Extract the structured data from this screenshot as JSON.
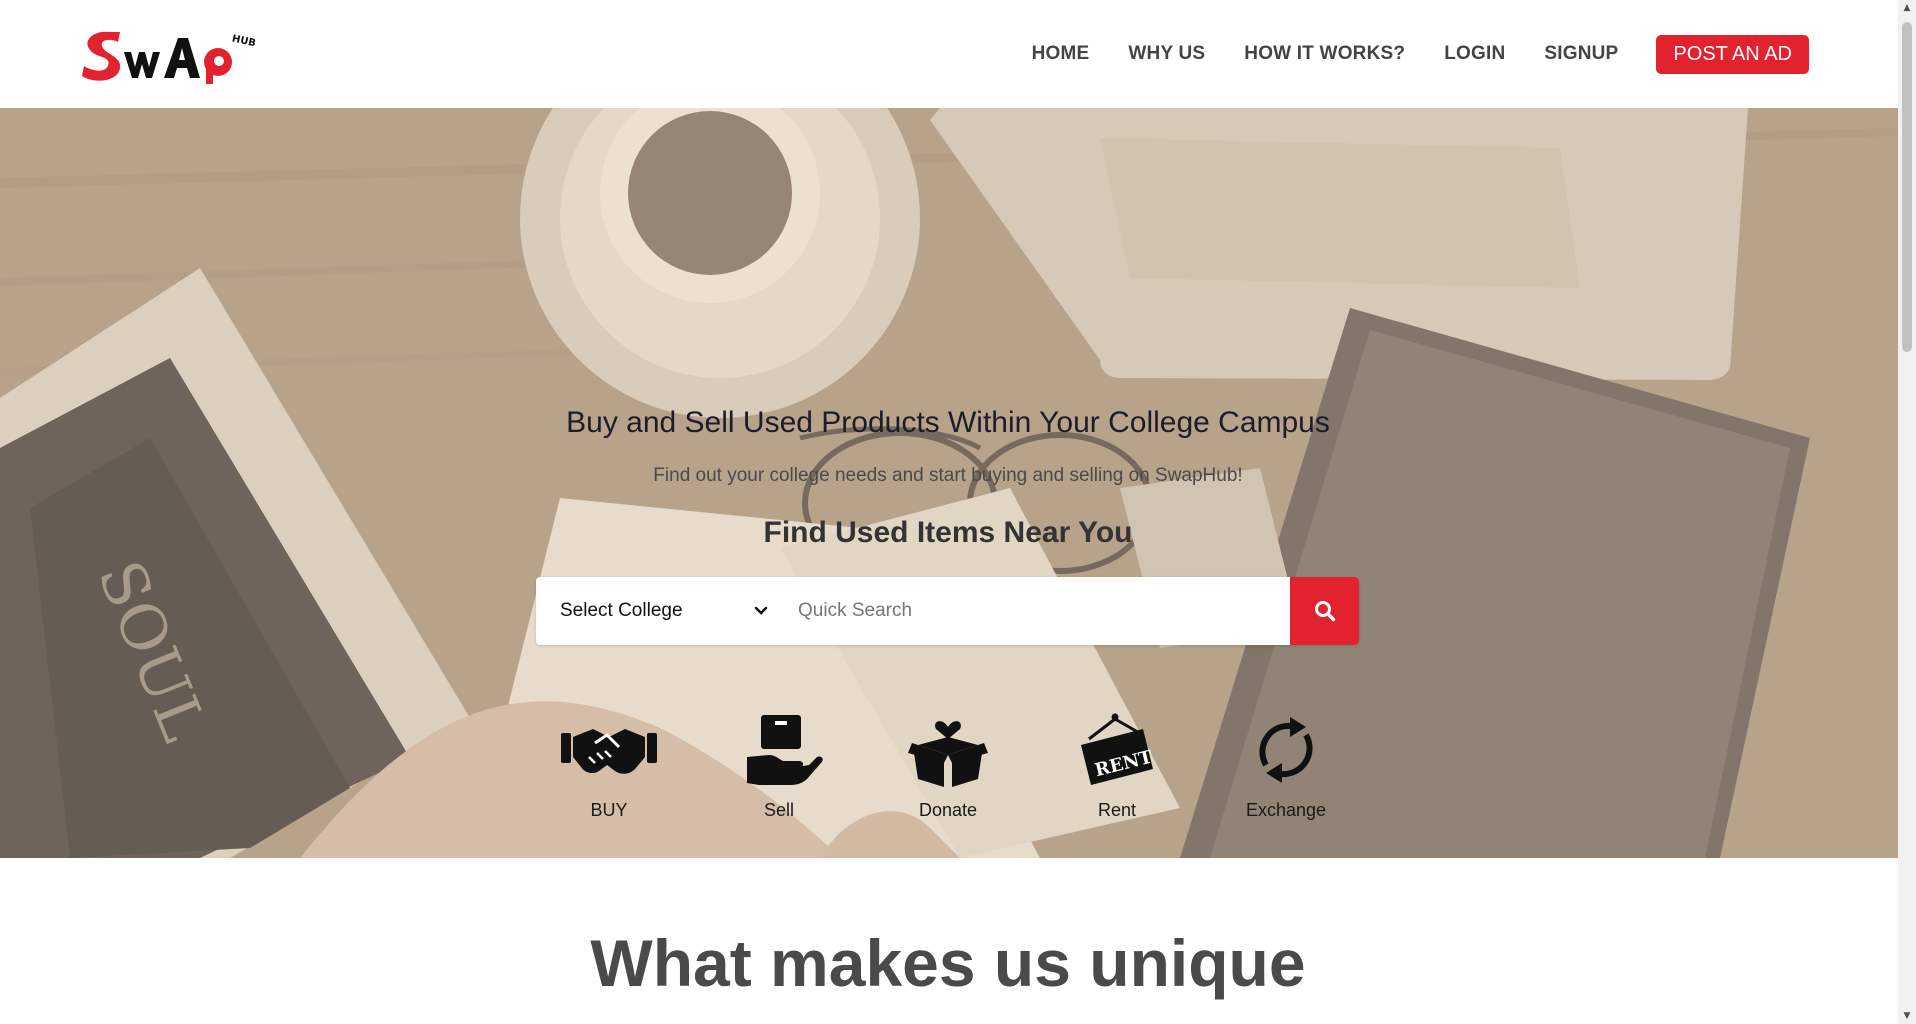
{
  "header": {
    "brand": "SwAp HUB",
    "nav": [
      "HOME",
      "WHY US",
      "HOW IT WORKS?",
      "LOGIN",
      "SIGNUP"
    ],
    "post_ad": "POST AN AD"
  },
  "hero": {
    "title": "Buy and Sell Used Products Within Your College Campus",
    "subtitle": "Find out your college needs and start buying and selling on SwapHub!",
    "find_heading": "Find Used Items Near You",
    "search": {
      "college_select": "Select College",
      "placeholder": "Quick Search"
    },
    "actions": [
      {
        "label": "BUY",
        "icon": "handshake-icon"
      },
      {
        "label": "Sell",
        "icon": "hand-box-icon"
      },
      {
        "label": "Donate",
        "icon": "box-heart-icon"
      },
      {
        "label": "Rent",
        "icon": "rent-sign-icon"
      },
      {
        "label": "Exchange",
        "icon": "exchange-arrows-icon"
      }
    ]
  },
  "unique_section": {
    "title": "What makes us unique"
  },
  "colors": {
    "accent": "#e3222f",
    "nav_text": "#444444",
    "hero_tint": "#a8937a"
  }
}
